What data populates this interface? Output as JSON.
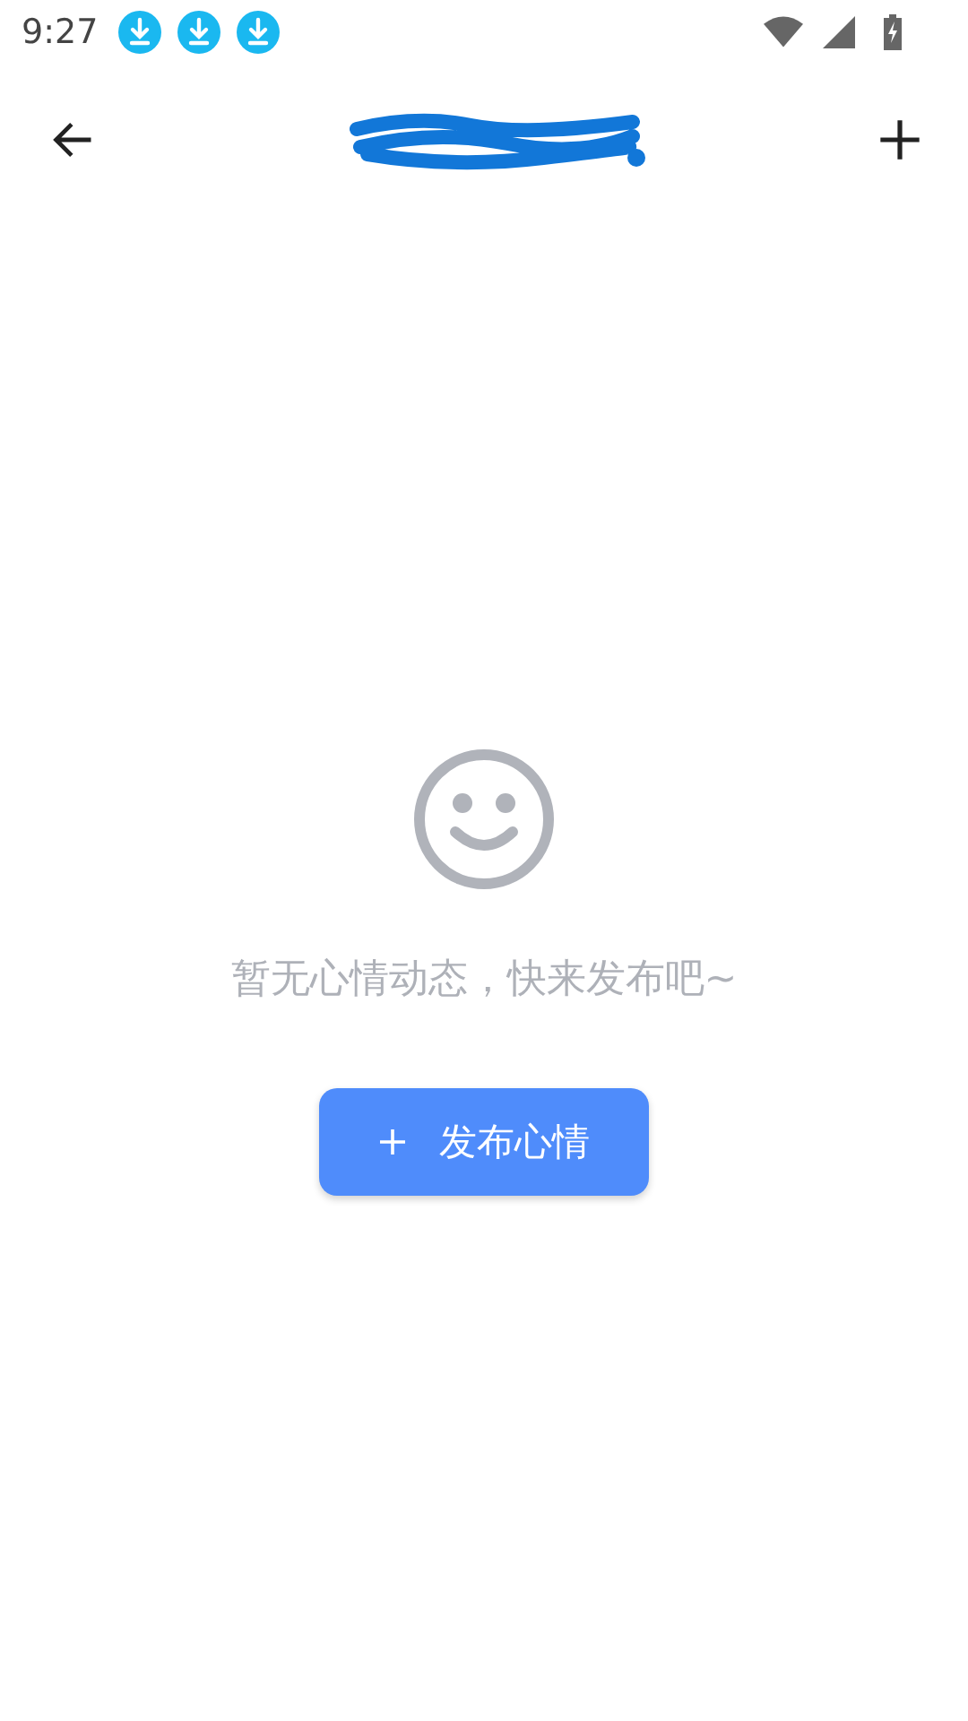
{
  "status_bar": {
    "time": "9:27",
    "notifications": [
      {
        "kind": "download"
      },
      {
        "kind": "download"
      },
      {
        "kind": "download"
      }
    ]
  },
  "header": {
    "title_redacted": true
  },
  "empty_state": {
    "message": "暂无心情动态，快来发布吧~",
    "button": "发布心情"
  }
}
